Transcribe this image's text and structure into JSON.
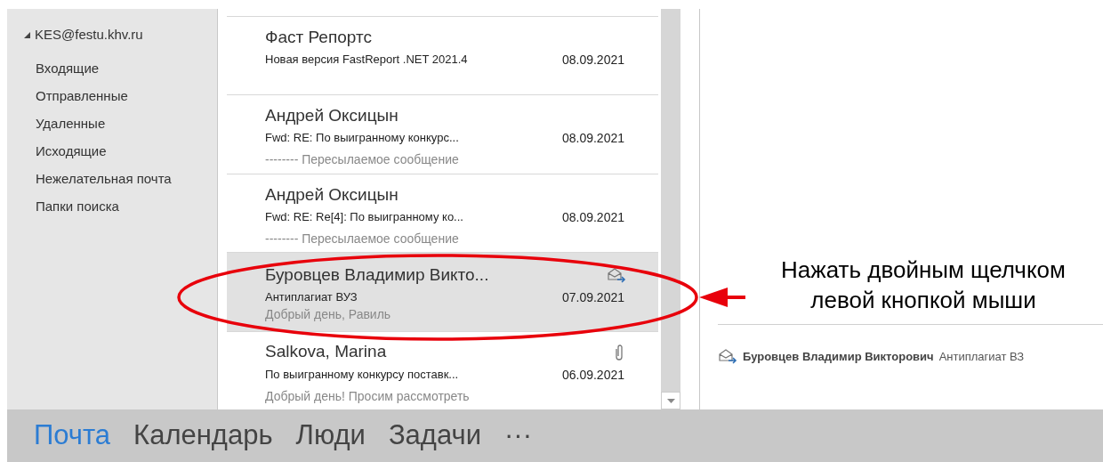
{
  "folder_pane": {
    "account": "KES@festu.khv.ru",
    "expanded": true,
    "folders": [
      {
        "label": "Входящие"
      },
      {
        "label": "Отправленные"
      },
      {
        "label": "Удаленные"
      },
      {
        "label": "Исходящие"
      },
      {
        "label": "Нежелательная почта"
      },
      {
        "label": "Папки поиска"
      }
    ]
  },
  "messages": [
    {
      "sender": "Фаст Репортс",
      "subject": "Новая версия FastReport .NET 2021.4",
      "date": "08.09.2021",
      "selected": false,
      "kind": "plain"
    },
    {
      "sender": "Андрей Оксицын",
      "subject": "Fwd: RE:  По выигранному конкурс...",
      "date": "08.09.2021",
      "preview": "-------- Пересылаемое сообщение",
      "selected": false,
      "kind": "plain"
    },
    {
      "sender": "Андрей Оксицын",
      "subject": "Fwd: RE: Re[4]: По выигранному ко...",
      "date": "08.09.2021",
      "preview": "-------- Пересылаемое сообщение",
      "selected": false,
      "kind": "plain"
    },
    {
      "sender": "Буровцев Владимир Викто...",
      "subject": "Антиплагиат ВУЗ",
      "date": "07.09.2021",
      "preview": "Добрый день, Равиль",
      "selected": true,
      "kind": "forwarded"
    },
    {
      "sender": "Salkova, Marina",
      "subject": "По выигранному конкурсу поставк...",
      "date": "06.09.2021",
      "preview": "Добрый день!  Просим рассмотреть",
      "selected": false,
      "kind": "attachment"
    }
  ],
  "reading_pane": {
    "sender": "Буровцев Владимир Викторович",
    "subject": "Антиплагиат ВЗ",
    "kind": "forwarded"
  },
  "navigation": [
    {
      "label": "Почта",
      "selected": true
    },
    {
      "label": "Календарь",
      "selected": false
    },
    {
      "label": "Люди",
      "selected": false
    },
    {
      "label": "Задачи",
      "selected": false
    },
    {
      "label": "···",
      "selected": false
    }
  ],
  "annotation": {
    "lines": [
      "Нажать двойным щелчком",
      "левой кнопкой мыши"
    ]
  }
}
